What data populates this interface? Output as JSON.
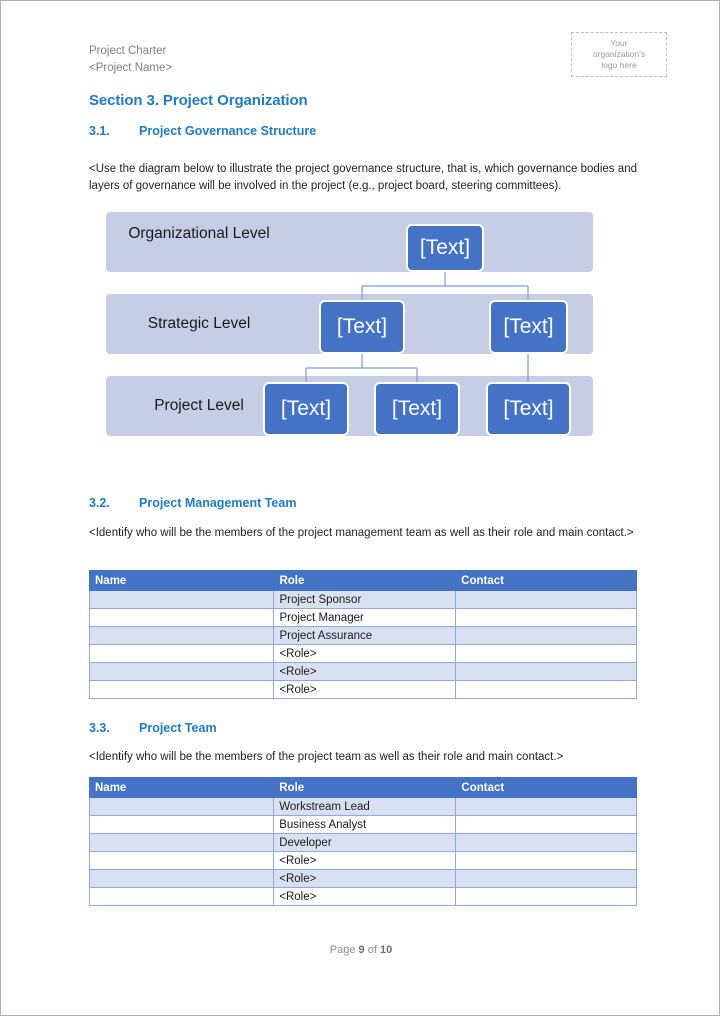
{
  "header": {
    "doc_title": "Project Charter",
    "project_name": "<Project Name>",
    "logo_placeholder": "Your\norganization's\nlogo here"
  },
  "section": {
    "title": "Section 3. Project Organization"
  },
  "sub_3_1": {
    "number": "3.1.",
    "title": "Project Governance Structure",
    "instruction": "<Use the diagram below to illustrate the project governance structure, that is, which governance bodies and layers of governance will be involved in the project (e.g., project board, steering committees)."
  },
  "diagram": {
    "levels": [
      {
        "label": "Organizational\nLevel"
      },
      {
        "label": "Strategic Level"
      },
      {
        "label": "Project Level"
      }
    ],
    "nodes": [
      {
        "level": 0,
        "label": "[Text]"
      },
      {
        "level": 1,
        "label": "[Text]"
      },
      {
        "level": 1,
        "label": "[Text]"
      },
      {
        "level": 2,
        "label": "[Text]"
      },
      {
        "level": 2,
        "label": "[Text]"
      },
      {
        "level": 2,
        "label": "[Text]"
      }
    ],
    "colors": {
      "band": "#C7CDE4",
      "node": "#4472C4",
      "connector": "#7E9BD4",
      "node_text": "#FFFFFF"
    }
  },
  "sub_3_2": {
    "number": "3.2.",
    "title": "Project Management Team",
    "instruction": "<Identify who will be the members of the project management team as well as their role and main contact.>"
  },
  "table_management": {
    "columns": [
      "Name",
      "Role",
      "Contact"
    ],
    "rows": [
      {
        "name": "",
        "role": "Project Sponsor",
        "contact": ""
      },
      {
        "name": "",
        "role": "Project Manager",
        "contact": ""
      },
      {
        "name": "",
        "role": "Project Assurance",
        "contact": ""
      },
      {
        "name": "",
        "role": "<Role>",
        "contact": ""
      },
      {
        "name": "",
        "role": "<Role>",
        "contact": ""
      },
      {
        "name": "",
        "role": "<Role>",
        "contact": ""
      }
    ]
  },
  "sub_3_3": {
    "number": "3.3.",
    "title": "Project Team",
    "instruction": "<Identify who will be the members of the project team as well as their role and main contact.>"
  },
  "table_team": {
    "columns": [
      "Name",
      "Role",
      "Contact"
    ],
    "rows": [
      {
        "name": "",
        "role": "Workstream Lead",
        "contact": ""
      },
      {
        "name": "",
        "role": "Business Analyst",
        "contact": ""
      },
      {
        "name": "",
        "role": "Developer",
        "contact": ""
      },
      {
        "name": "",
        "role": "<Role>",
        "contact": ""
      },
      {
        "name": "",
        "role": "<Role>",
        "contact": ""
      },
      {
        "name": "",
        "role": "<Role>",
        "contact": ""
      }
    ]
  },
  "footer": {
    "prefix": "Page ",
    "current": "9",
    "middle": " of ",
    "total": "10"
  },
  "theme": {
    "heading_blue": "#1F7BC4",
    "table_header_blue": "#4472C4",
    "table_band_blue": "#D9E0F2",
    "table_border_blue": "#8EAADB"
  }
}
